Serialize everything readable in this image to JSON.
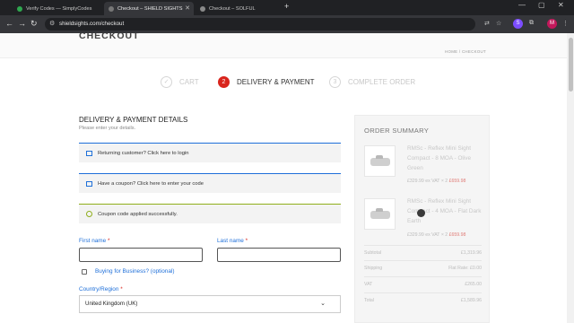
{
  "browser": {
    "tabs": [
      {
        "title": "Verify Codes — SimplyCodes",
        "fav": "#2fa84f",
        "active": false
      },
      {
        "title": "Checkout – SHIELD SIGHTS",
        "fav": "#777777",
        "active": true
      },
      {
        "title": "Checkout – SOLFUL",
        "fav": "#8a8a8a",
        "active": false
      }
    ],
    "url": "shieldsights.com/checkout",
    "profile_initial": "M"
  },
  "page": {
    "title": "CHECKOUT",
    "breadcrumb": "HOME / CHECKOUT"
  },
  "steps": [
    {
      "num": "✓",
      "label": "CART",
      "active": false
    },
    {
      "num": "2",
      "label": "DELIVERY & PAYMENT",
      "active": true
    },
    {
      "num": "3",
      "label": "COMPLETE ORDER",
      "active": false
    }
  ],
  "form": {
    "title": "DELIVERY & PAYMENT DETAILS",
    "subtitle": "Please enter your details.",
    "returning_customer": "Returning customer? Click here to login",
    "coupon_prompt": "Have a coupon? Click here to enter your code",
    "coupon_success": "Coupon code applied successfully.",
    "first_name_label": "First name",
    "last_name_label": "Last name",
    "required_mark": "*",
    "business_label": "Buying for Business? (optional)",
    "country_label": "Country/Region",
    "country_value": "United Kingdom (UK)"
  },
  "summary": {
    "title": "ORDER SUMMARY",
    "items": [
      {
        "name": "RMSc - Reflex Mini Sight Compact - 8 MOA - Olive Green",
        "price": "£329.99",
        "tax_note": "ex VAT",
        "qty": "× 2",
        "total": "£659.98"
      },
      {
        "name": "RMSc - Reflex Mini Sight Compact - 4 MOA - Flat Dark Earth",
        "price": "£329.99",
        "tax_note": "ex VAT",
        "qty": "× 2",
        "total": "£659.98"
      }
    ],
    "rows": [
      {
        "label": "Subtotal",
        "value": "£1,319.96"
      },
      {
        "label": "Shipping",
        "value": "Flat Rate: £0.00"
      },
      {
        "label": "VAT",
        "value": "£265.00"
      },
      {
        "label": "Total",
        "value": "£1,589.96"
      }
    ]
  },
  "colors": {
    "accent": "#d9251d",
    "link": "#1e6fd9",
    "success": "#8fae1b"
  }
}
